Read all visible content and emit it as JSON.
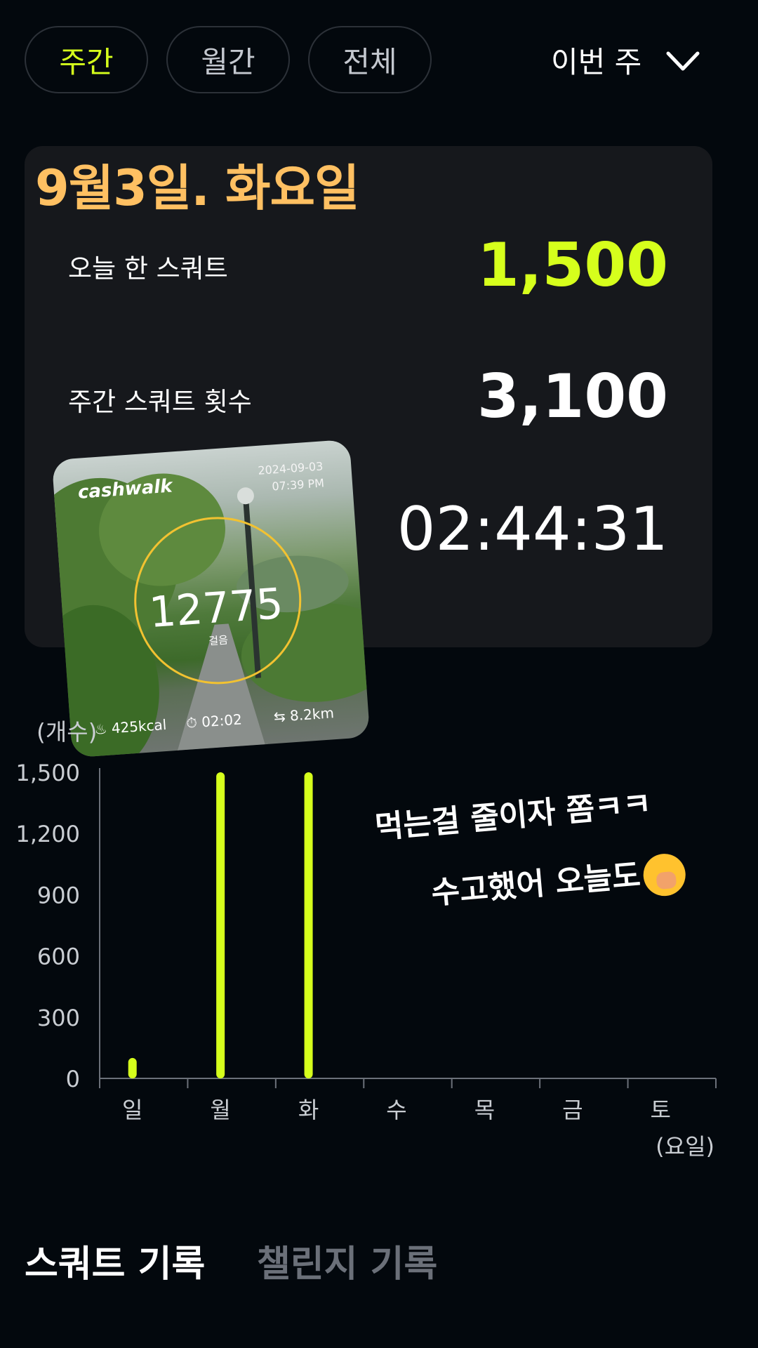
{
  "filters": {
    "tabs": [
      {
        "label": "주간",
        "active": true
      },
      {
        "label": "월간",
        "active": false
      },
      {
        "label": "전체",
        "active": false
      }
    ],
    "period_label": "이번 주"
  },
  "summary": {
    "date_title": "9월3일.  화요일",
    "today_label": "오늘 한 스쿼트",
    "today_value": "1,500",
    "weekly_label": "주간 스쿼트 횟수",
    "weekly_value": "3,100",
    "time_value": "02:44:31"
  },
  "photo": {
    "brand": "cashwalk",
    "date": "2024-09-03",
    "time": "07:39 PM",
    "steps": "12775",
    "steps_label": "걸음",
    "kcal": "425kcal",
    "duration": "02:02",
    "distance": "8.2km"
  },
  "chart_data": {
    "type": "bar",
    "categories": [
      "일",
      "월",
      "화",
      "수",
      "목",
      "금",
      "토"
    ],
    "values": [
      100,
      1500,
      1500,
      0,
      0,
      0,
      0
    ],
    "yticks": [
      "1,500",
      "1,200",
      "900",
      "600",
      "300",
      "0"
    ],
    "ylim": [
      0,
      1500
    ],
    "ylabel": "(개수)",
    "xlabel": "(요일)",
    "bar_color": "#d6ff1c"
  },
  "note": {
    "line1": "먹는걸  줄이자  쫌ㅋㅋ",
    "line2": "수고했어  오늘도"
  },
  "bottom_tabs": {
    "squat": "스쿼트 기록",
    "challenge": "챌린지 기록"
  },
  "colors": {
    "accent": "#d6ff1c",
    "date_title": "#ffc062",
    "background": "#03080d",
    "card": "#16181c"
  }
}
